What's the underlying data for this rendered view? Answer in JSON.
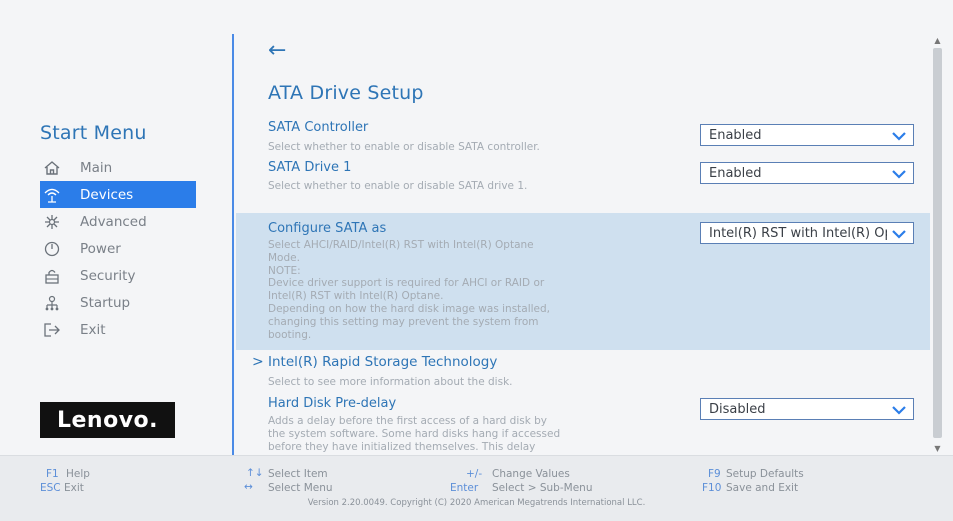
{
  "sidebar": {
    "title": "Start Menu",
    "items": [
      {
        "label": "Main",
        "icon": "home-icon",
        "active": false
      },
      {
        "label": "Devices",
        "icon": "devices-icon",
        "active": true
      },
      {
        "label": "Advanced",
        "icon": "advanced-icon",
        "active": false
      },
      {
        "label": "Power",
        "icon": "power-icon",
        "active": false
      },
      {
        "label": "Security",
        "icon": "lock-icon",
        "active": false
      },
      {
        "label": "Startup",
        "icon": "startup-icon",
        "active": false
      },
      {
        "label": "Exit",
        "icon": "exit-icon",
        "active": false
      }
    ],
    "logo": "Lenovo"
  },
  "header": {
    "back": "←",
    "title": "ATA Drive Setup"
  },
  "settings": {
    "sata_controller": {
      "label": "SATA Controller",
      "help": "Select whether to enable or disable SATA controller.",
      "value": "Enabled"
    },
    "sata_drive_1": {
      "label": "SATA Drive 1",
      "help": "Select whether to enable or disable SATA drive 1.",
      "value": "Enabled"
    },
    "configure_sata": {
      "label": "Configure SATA as",
      "help": [
        "Select AHCI/RAID/Intel(R) RST with Intel(R) Optane",
        "Mode.",
        "NOTE:",
        "Device driver support is required  for AHCI or RAID or",
        "Intel(R) RST with Intel(R) Optane.",
        "Depending on how the hard disk image was installed,",
        "changing this setting may prevent the system from",
        "booting."
      ],
      "value": "Intel(R) RST with Intel(R) Optane"
    },
    "rst": {
      "arrow": ">",
      "label": "Intel(R) Rapid Storage Technology",
      "help": "Select to see more information about the disk."
    },
    "predelay": {
      "label": "Hard Disk Pre-delay",
      "help": [
        "Adds a delay before the first access of a hard disk by",
        "the system software. Some hard disks hang if accessed",
        "before they have initialized themselves. This delay"
      ],
      "value": "Disabled"
    }
  },
  "footer": {
    "f1_key": "F1",
    "f1_desc": "Help",
    "esc_key": "ESC",
    "esc_desc": "Exit",
    "item_key": "↑↓",
    "item_desc": "Select Item",
    "menu_key": "↔",
    "menu_desc": "Select Menu",
    "change_key": "+/-",
    "change_desc": "Change Values",
    "enter_key": "Enter",
    "enter_desc": "Select > Sub-Menu",
    "f9_key": "F9",
    "f9_desc": "Setup Defaults",
    "f10_key": "F10",
    "f10_desc": "Save and Exit",
    "version": "Version 2.20.0049. Copyright (C) 2020 American Megatrends International LLC."
  },
  "colors": {
    "accent": "#2e75b6",
    "active_bg": "#2b7de9",
    "selected_bg": "#cfe0ef"
  }
}
